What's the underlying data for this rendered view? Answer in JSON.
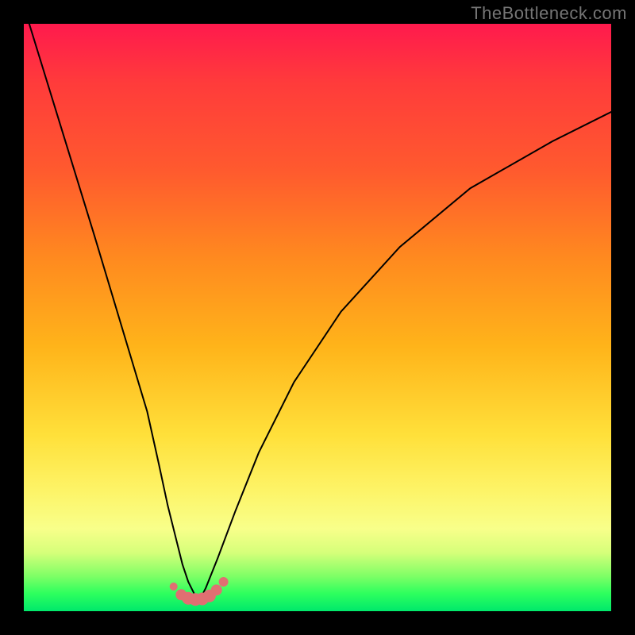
{
  "watermark": "TheBottleneck.com",
  "chart_data": {
    "type": "line",
    "title": "",
    "xlabel": "",
    "ylabel": "",
    "xlim": [
      0,
      100
    ],
    "ylim": [
      0,
      100
    ],
    "grid": false,
    "legend": false,
    "series": [
      {
        "name": "left-curve",
        "x": [
          0,
          4,
          8,
          12,
          15,
          18,
          21,
          23,
          24.5,
          26,
          27,
          28,
          29,
          30
        ],
        "y": [
          103,
          90,
          77,
          64,
          54,
          44,
          34,
          25,
          18,
          12,
          8,
          5,
          3,
          2
        ],
        "color": "#000000"
      },
      {
        "name": "right-curve",
        "x": [
          30,
          31,
          33,
          36,
          40,
          46,
          54,
          64,
          76,
          90,
          100
        ],
        "y": [
          2,
          4,
          9,
          17,
          27,
          39,
          51,
          62,
          72,
          80,
          85
        ],
        "color": "#000000"
      },
      {
        "name": "bottom-dots",
        "type": "scatter",
        "x": [
          25.5,
          26.8,
          28.0,
          29.2,
          30.4,
          31.6,
          32.8,
          34.0
        ],
        "y": [
          4.2,
          2.8,
          2.2,
          2.0,
          2.1,
          2.6,
          3.6,
          5.0
        ],
        "size": [
          5,
          7,
          8,
          8,
          8,
          8,
          7,
          6
        ],
        "color": "#e06f72"
      }
    ],
    "annotations": []
  }
}
